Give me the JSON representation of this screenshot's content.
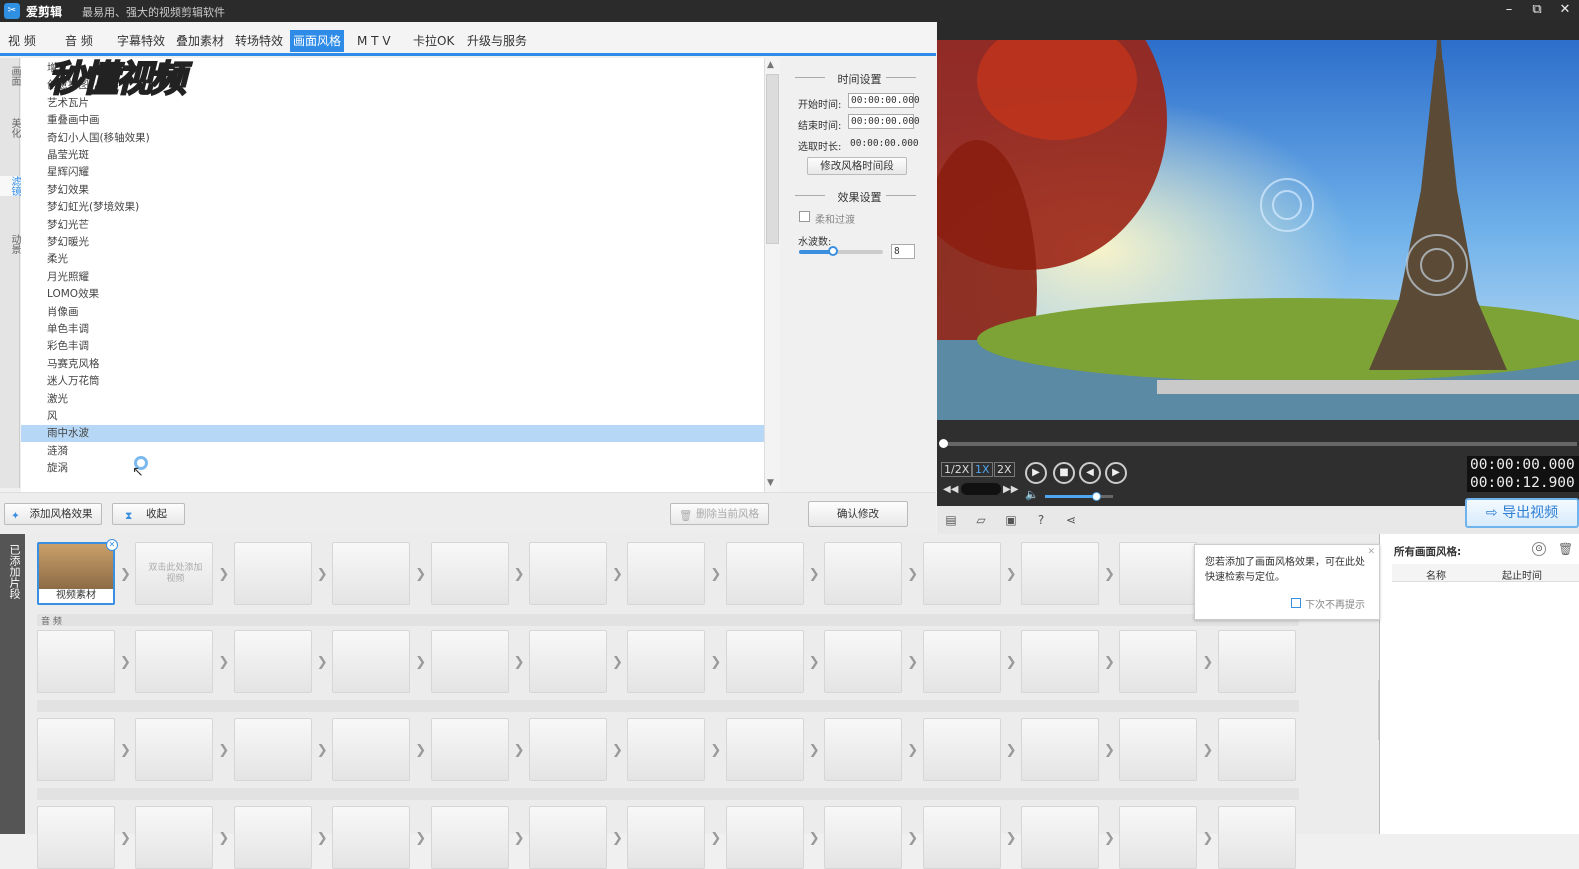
{
  "titlebar": {
    "app_name": "爱剪辑",
    "slogan": "最易用、强大的视频剪辑软件",
    "minimize": "–",
    "restore": "⧉",
    "close": "✕"
  },
  "watermark": "秒懂视频",
  "tabs": [
    {
      "label": "视  频"
    },
    {
      "label": "音  频"
    },
    {
      "label": "字幕特效"
    },
    {
      "label": "叠加素材"
    },
    {
      "label": "转场特效"
    },
    {
      "label": "画面风格"
    },
    {
      "label": "M T V"
    },
    {
      "label": "卡拉OK"
    },
    {
      "label": "升级与服务"
    }
  ],
  "vtabs": [
    {
      "label": "画面"
    },
    {
      "label": "美化"
    },
    {
      "label": "滤镜"
    },
    {
      "label": "动景"
    }
  ],
  "filters": [
    "增",
    "创意拼图",
    "艺术瓦片",
    "重叠画中画",
    "奇幻小人国(移轴效果)",
    "晶莹光斑",
    "星辉闪耀",
    "梦幻效果",
    "梦幻虹光(梦境效果)",
    "梦幻光芒",
    "梦幻暖光",
    "柔光",
    "月光照耀",
    "LOMO效果",
    "肖像画",
    "单色丰调",
    "彩色丰调",
    "马赛克风格",
    "迷人万花筒",
    "激光",
    "风",
    "雨中水波",
    "涟漪",
    "旋涡"
  ],
  "selected_filter_index": 21,
  "settings": {
    "time_title": "时间设置",
    "start_label": "开始时间:",
    "start_value": "00:00:00.000",
    "end_label": "结束时间:",
    "end_value": "00:00:00.000",
    "duration_label": "选取时长:",
    "duration_value": "00:00:00.000",
    "modify_time_button": "修改风格时间段",
    "effect_title": "效果设置",
    "smooth_label": "柔和过渡",
    "wave_label": "水波数:",
    "wave_value": "8",
    "wave_slider_level": 0.4,
    "confirm_button": "确认修改"
  },
  "bottom_toolbar": {
    "add_effect": "添加风格效果",
    "collapse": "收起",
    "delete_current": "删除当前风格"
  },
  "player": {
    "speeds": [
      "1/2X",
      "1X",
      "2X"
    ],
    "time_current": "00:00:00.000",
    "time_total": "00:00:12.900",
    "volume_level": 0.75,
    "export_label": "导出视频"
  },
  "timeline": {
    "side_label": "已添加片段",
    "first_clip_label": "视频素材",
    "add_hint": "双击此处添加视频",
    "audio_label": "音 频"
  },
  "tooltip": {
    "text": "您若添加了画面风格效果，可在此处快速检索与定位。",
    "checkbox": "下次不再提示"
  },
  "right_panel": {
    "title": "所有画面风格:",
    "col_name": "名称",
    "col_time": "起止时间"
  },
  "colors": {
    "accent": "#2e8be8",
    "selected_row": "#b6d7f5",
    "titlebar": "#2b2b2b"
  }
}
